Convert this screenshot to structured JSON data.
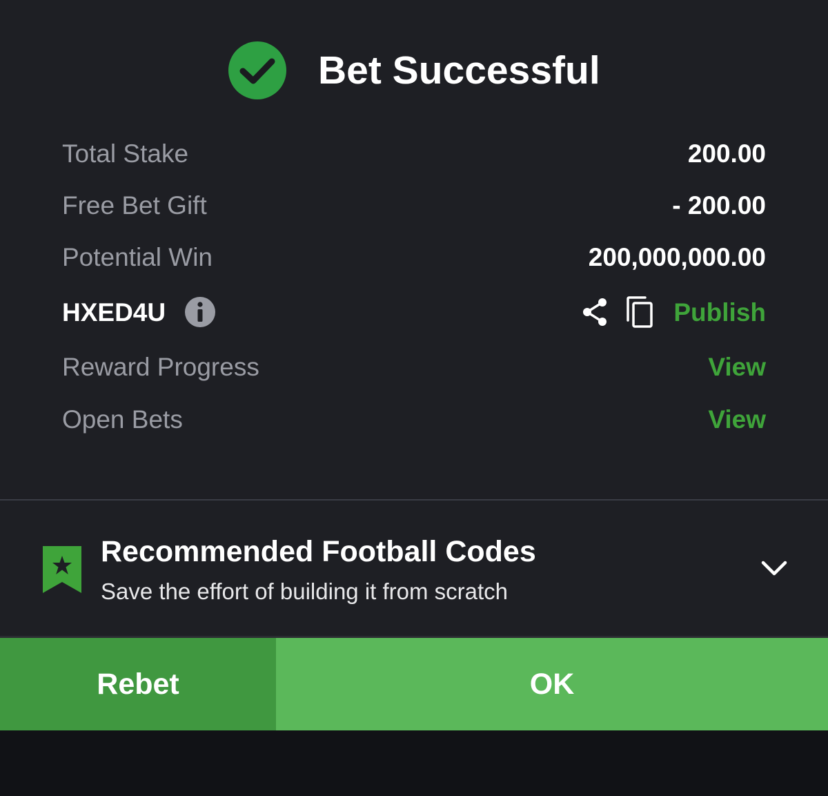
{
  "header": {
    "title": "Bet Successful"
  },
  "summary": {
    "total_stake_label": "Total Stake",
    "total_stake_value": "200.00",
    "free_bet_label": "Free Bet Gift",
    "free_bet_value": "- 200.00",
    "potential_win_label": "Potential Win",
    "potential_win_value": "200,000,000.00",
    "booking_code": "HXED4U",
    "publish_label": "Publish",
    "reward_progress_label": "Reward Progress",
    "reward_progress_link": "View",
    "open_bets_label": "Open Bets",
    "open_bets_link": "View"
  },
  "recommended": {
    "title": "Recommended Football Codes",
    "subtitle": "Save the effort of building it from scratch"
  },
  "actions": {
    "rebet_label": "Rebet",
    "ok_label": "OK"
  },
  "icons": {
    "success": "check-circle-icon",
    "info": "info-icon",
    "share": "share-icon",
    "copy": "copy-icon",
    "bookmark": "bookmark-star-icon",
    "expand": "chevron-down-icon"
  },
  "colors": {
    "background": "#1e1f24",
    "accent_green": "#3fa43a",
    "success_green": "#2ea043",
    "rebet_button": "#409840",
    "ok_button": "#5bb85a",
    "label_gray": "#9a9ca4"
  }
}
